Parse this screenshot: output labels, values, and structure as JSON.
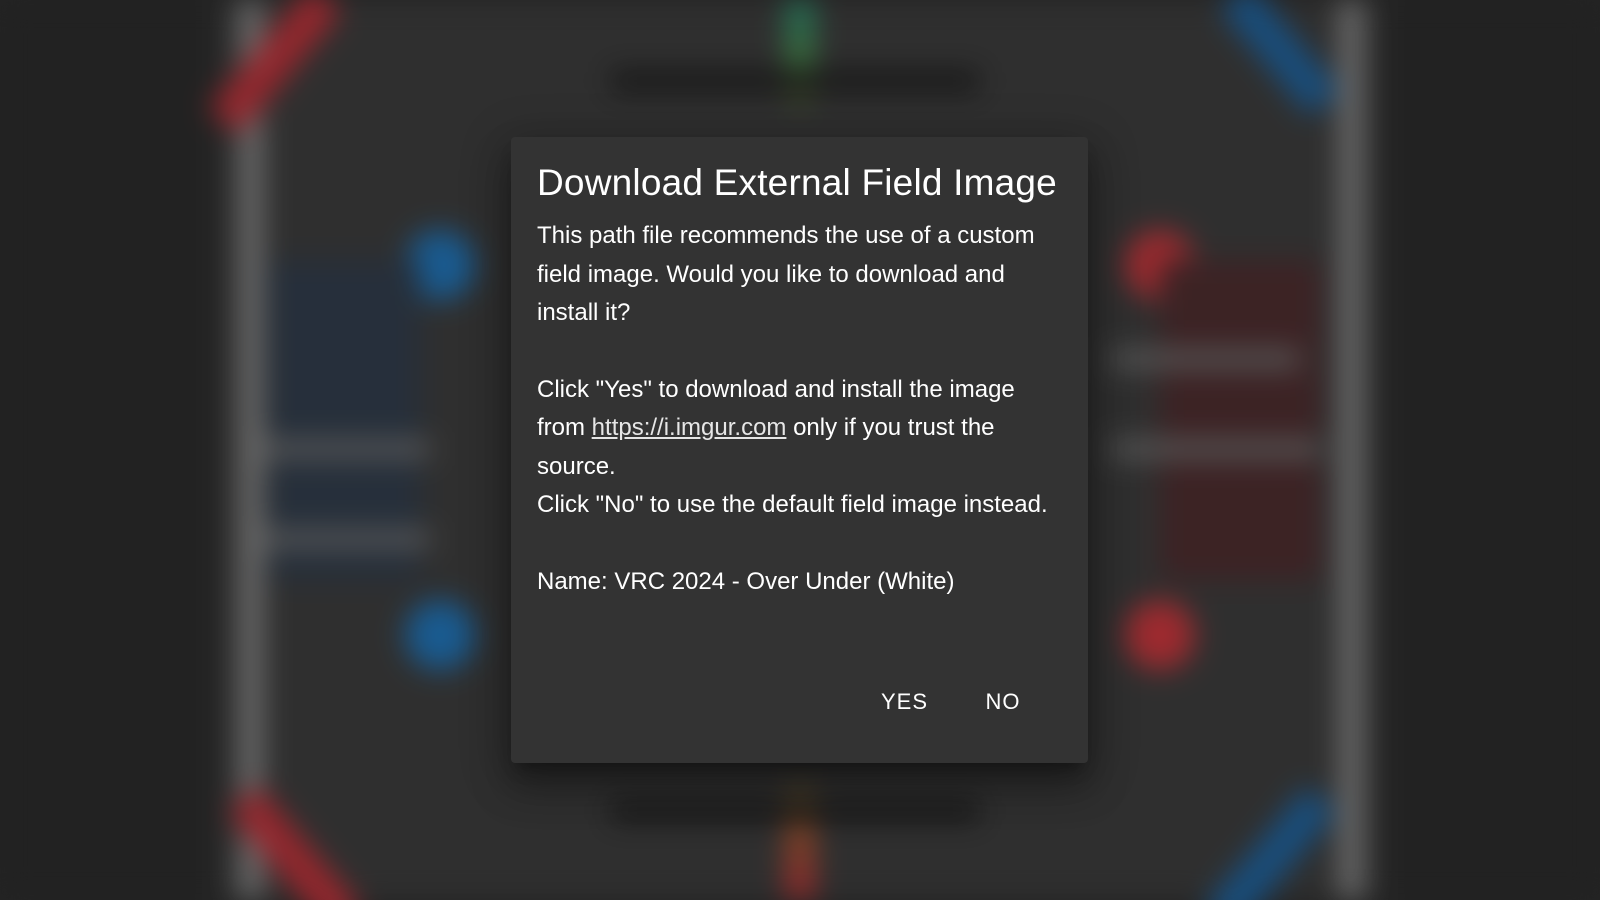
{
  "dialog": {
    "title": "Download External Field Image",
    "line1": "This path file recommends the use of a custom field image. Would you like to download and install it?",
    "line2_prefix": "Click \"Yes\" to download and install the image from ",
    "link_text": "https://i.imgur.com",
    "line2_suffix": " only if you trust the source.",
    "line3": "Click \"No\" to use the default field image instead.",
    "name_line": "Name: VRC 2024 - Over Under (White)",
    "yes_label": "YES",
    "no_label": "NO"
  },
  "colors": {
    "dialog_bg": "#333333",
    "text": "#ffffff",
    "red_alliance": "#c0343a",
    "blue_alliance": "#1f6fb0"
  }
}
